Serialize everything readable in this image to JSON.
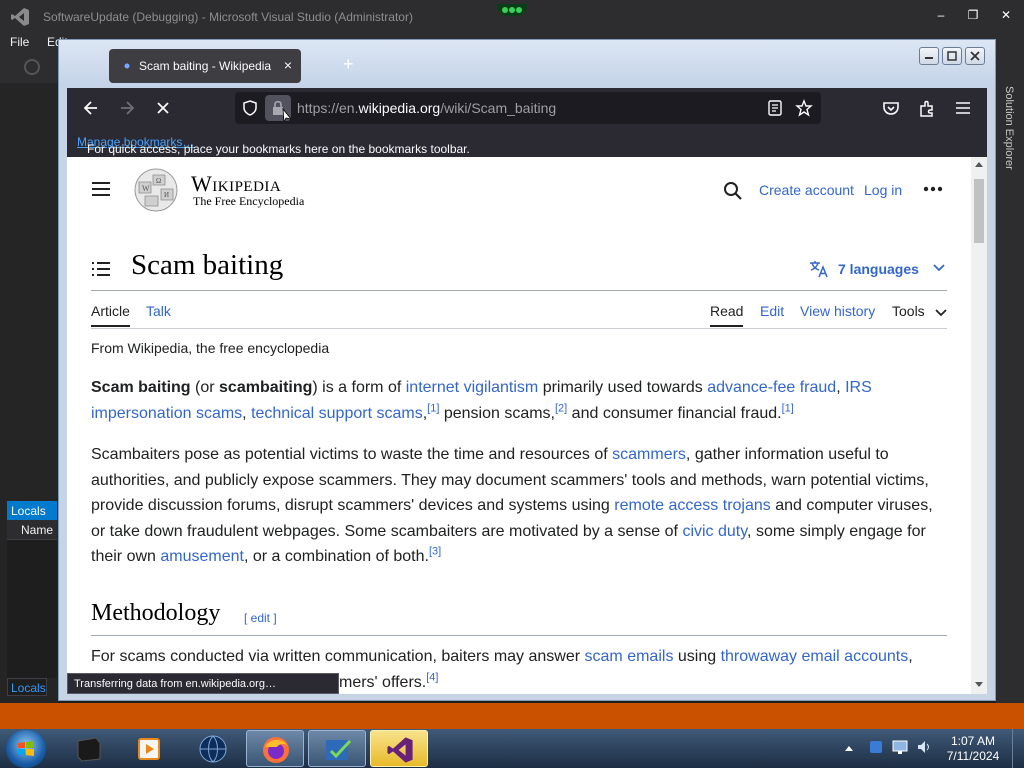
{
  "vs": {
    "title": "SoftwareUpdate (Debugging) - Microsoft Visual Studio (Administrator)",
    "menu": [
      "File",
      "Edit"
    ],
    "window_controls": {
      "minimize": "–",
      "maximize": "❐",
      "close": "✕"
    },
    "locals_tab": "Locals",
    "locals_column": "Name",
    "locals_bottom_tab": "Locals",
    "solution_explorer": "Solution Explorer",
    "colors": {
      "background": "#1e1e1e",
      "status_bar": "#ca5100",
      "accent": "#007acc"
    }
  },
  "browser": {
    "tab_title": "Scam baiting - Wikipedia",
    "tab_close": "×",
    "new_tab": "+",
    "url_prefix": "https://en.",
    "url_domain": "wikipedia.org",
    "url_path": "/wiki/Scam_baiting",
    "bookmarks_message": "For quick access, place your bookmarks here on the bookmarks toolbar.",
    "manage_bookmarks": "Manage bookmarks…",
    "status_text": "Transferring data from en.wikipedia.org…",
    "colors": {
      "toolbar": "#2b2a33",
      "urlbar": "#1c1b22",
      "link": "#45a1ff"
    }
  },
  "wiki": {
    "wordmark": "Wikipedia",
    "tagline": "The Free Encyclopedia",
    "create_account": "Create account",
    "log_in": "Log in",
    "title": "Scam baiting",
    "languages": "7 languages",
    "tabs": {
      "article": "Article",
      "talk": "Talk",
      "read": "Read",
      "edit": "Edit",
      "view_history": "View history",
      "tools": "Tools"
    },
    "from": "From Wikipedia, the free encyclopedia",
    "p1": {
      "t1": "Scam baiting",
      "t2": " (or ",
      "t3": "scambaiting",
      "t4": ") is a form of ",
      "l1": "internet vigilantism",
      "t5": " primarily used towards ",
      "l2": "advance-fee fraud",
      "t6": ", ",
      "l3": "IRS impersonation scams",
      "t7": ", ",
      "l4": "technical support scams",
      "t8": ",",
      "s1": "[1]",
      "t9": " pension scams,",
      "s2": "[2]",
      "t10": " and consumer financial fraud.",
      "s3": "[1]"
    },
    "p2": {
      "t1": "Scambaiters pose as potential victims to waste the time and resources of ",
      "l1": "scammers",
      "t2": ", gather information useful to authorities, and publicly expose scammers. They may document scammers' tools and methods, warn potential victims, provide discussion forums, disrupt scammers' devices and systems using ",
      "l2": "remote access trojans",
      "t3": " and computer viruses, or take down fraudulent webpages. Some scambaiters are motivated by a sense of ",
      "l3": "civic duty",
      "t4": ", some simply engage for their own ",
      "l4": "amusement",
      "t5": ", or a combination of both.",
      "s1": "[3]"
    },
    "section": "Methodology",
    "section_edit": "[ edit ]",
    "p3": {
      "t1": "For scams conducted via written communication, baiters may answer ",
      "l1": "scam emails",
      "t2": " using ",
      "l2": "throwaway email accounts",
      "t3": ",",
      "t4": "mers' offers.",
      "s1": "[4]"
    }
  },
  "taskbar": {
    "time": "1:07 AM",
    "date": "7/11/2024"
  }
}
